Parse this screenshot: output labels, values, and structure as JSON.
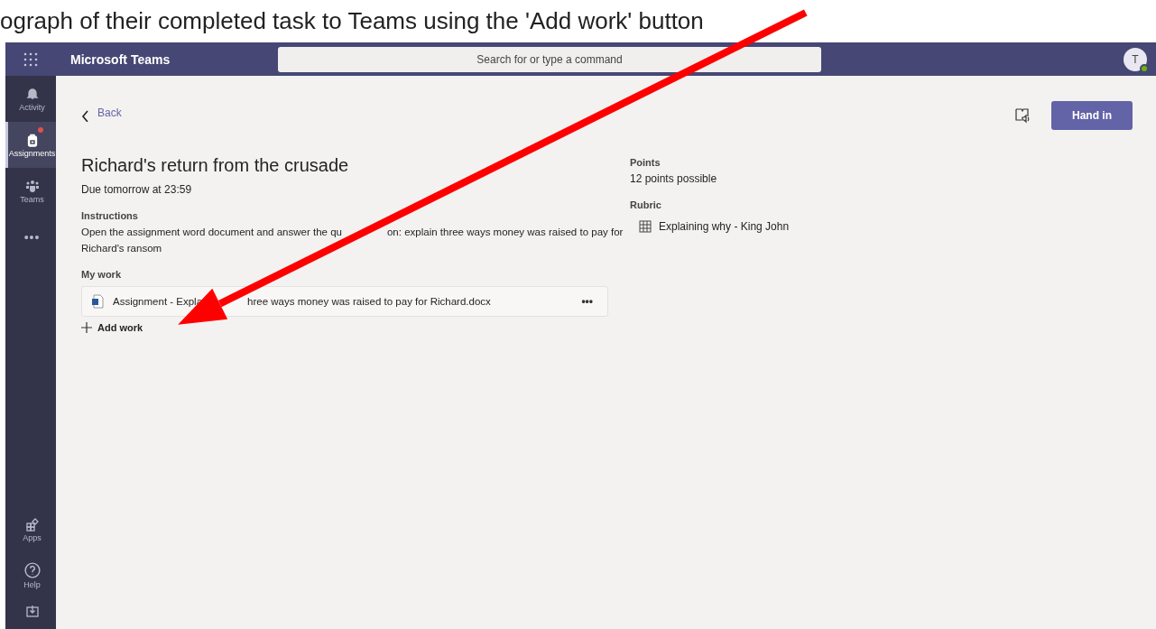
{
  "caption": "ograph of their completed task to Teams using the 'Add work' button",
  "app_bar": {
    "title": "Microsoft Teams",
    "search": {
      "placeholder": "Search for or type a command"
    },
    "avatar": "T"
  },
  "rail": {
    "items": [
      {
        "label": "Activity",
        "kind": "bell",
        "selected": false,
        "badge": false
      },
      {
        "label": "Assignments",
        "kind": "bag",
        "selected": true,
        "badge": true
      },
      {
        "label": "Teams",
        "kind": "people",
        "selected": false,
        "badge": false
      },
      {
        "label": "•••",
        "kind": "more",
        "selected": false,
        "badge": false
      }
    ],
    "bottom_items": [
      {
        "label": "Apps",
        "kind": "apps"
      },
      {
        "label": "Help",
        "kind": "help"
      },
      {
        "kind": "download"
      }
    ]
  },
  "page": {
    "back": "Back",
    "hand_in": "Hand in",
    "title": "Richard's return from the crusade",
    "due": "Due tomorrow at 23:59",
    "instructions_label": "Instructions",
    "instructions": [
      "Open the assignment word document and answer the qu",
      "on: explain three ways money was raised to pay for",
      "Richard's ransom"
    ],
    "my_work_label": "My work",
    "files": [
      {
        "name": [
          "Assignment - Expla",
          "hree ways money was raised to pay for Richard.docx"
        ],
        "more": "•••"
      }
    ],
    "add_work": "Add work",
    "points_label": "Points",
    "points": "12 points possible",
    "rubric_label": "Rubric",
    "rubric": "Explaining why - King John"
  }
}
